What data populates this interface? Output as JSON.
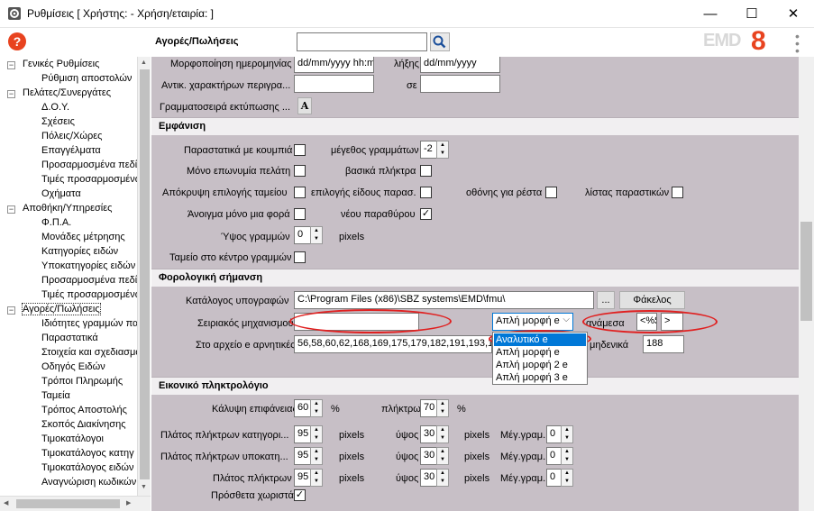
{
  "window": {
    "title": "Ρυθμίσεις   [ Χρήστης: - Χρήση/εταιρία: ]",
    "minimize": "—",
    "maximize": "☐",
    "close": "✕"
  },
  "toolbar": {
    "help": "?",
    "label": "Αγορές/Πωλήσεις",
    "search_value": "",
    "logo_text": "EMD",
    "logo_num": "8"
  },
  "tree": [
    {
      "label": "Γενικές Ρυθμίσεις",
      "level": 0,
      "toggle": "−"
    },
    {
      "label": "Ρύθμιση αποστολών",
      "level": 1
    },
    {
      "label": "Πελάτες/Συνεργάτες",
      "level": 0,
      "toggle": "−"
    },
    {
      "label": "Δ.Ο.Υ.",
      "level": 1
    },
    {
      "label": "Σχέσεις",
      "level": 1
    },
    {
      "label": "Πόλεις/Χώρες",
      "level": 1
    },
    {
      "label": "Επαγγέλματα",
      "level": 1
    },
    {
      "label": "Προσαρμοσμένα πεδί",
      "level": 1
    },
    {
      "label": "Τιμές προσαρμοσμένων",
      "level": 1
    },
    {
      "label": "Οχήματα",
      "level": 1
    },
    {
      "label": "Αποθήκη/Υπηρεσίες",
      "level": 0,
      "toggle": "−"
    },
    {
      "label": "Φ.Π.Α.",
      "level": 1
    },
    {
      "label": "Μονάδες μέτρησης",
      "level": 1
    },
    {
      "label": "Κατηγορίες ειδών",
      "level": 1
    },
    {
      "label": "Υποκατηγορίες ειδών",
      "level": 1
    },
    {
      "label": "Προσαρμοσμένα πεδί",
      "level": 1
    },
    {
      "label": "Τιμές προσαρμοσμένων",
      "level": 1
    },
    {
      "label": "Αγορές/Πωλήσεις",
      "level": 0,
      "toggle": "−",
      "selected": true
    },
    {
      "label": "Ιδιότητες γραμμών πα",
      "level": 1
    },
    {
      "label": "Παραστατικά",
      "level": 1
    },
    {
      "label": "Στοιχεία και σχεδιασμό",
      "level": 1
    },
    {
      "label": "Οδηγός Ειδών",
      "level": 1
    },
    {
      "label": "Τρόποι Πληρωμής",
      "level": 1
    },
    {
      "label": "Ταμεία",
      "level": 1
    },
    {
      "label": "Τρόπος Αποστολής",
      "level": 1
    },
    {
      "label": "Σκοπός Διακίνησης",
      "level": 1
    },
    {
      "label": "Τιμοκατάλογοι",
      "level": 1
    },
    {
      "label": "Τιμοκατάλογος κατηγ",
      "level": 1
    },
    {
      "label": "Τιμοκατάλογος ειδών",
      "level": 1
    },
    {
      "label": "Αναγνώριση κωδικών",
      "level": 1
    }
  ],
  "top": {
    "date_format_label": "Μορφοποίηση ημερομηνίας",
    "date_format_value": "dd/mm/yyyy hh:m",
    "expiry_label": "λήξης",
    "expiry_value": "dd/mm/yyyy",
    "replace_chars_label": "Αντικ. χαρακτήρων περιγρα...",
    "replace_chars_value": "",
    "with_label": "σε",
    "with_value": "",
    "print_font_label": "Γραμματοσειρά εκτύπωσης ...",
    "print_font_button": "A"
  },
  "appearance": {
    "header": "Εμφάνιση",
    "docs_buttons": "Παραστατικά με κουμπιά",
    "docs_buttons_checked": false,
    "row_size_label": "μέγεθος γραμμάτων",
    "row_size_value": "-2",
    "named_only": "Μόνο επωνυμία πελάτη",
    "named_only_checked": false,
    "basic_keys": "βασικά πλήκτρα",
    "basic_keys_checked": false,
    "hide_cash": "Απόκρυψη επιλογής ταμείου",
    "hide_cash_checked": false,
    "doc_type": "επιλογής είδους παρασ.",
    "doc_type_checked": false,
    "screen_change": "οθόνης για ρέστα",
    "screen_change_checked": false,
    "doc_list": "λίστας παραστικών",
    "doc_list_checked": false,
    "open_once": "Άνοιγμα μόνο μια φορά",
    "open_once_checked": false,
    "new_window": "νέου παραθύρου",
    "new_window_checked": true,
    "row_height_label": "Ύψος γραμμών",
    "row_height_value": "0",
    "row_height_unit": "pixels",
    "cash_center": "Ταμείο στο κέντρο γραμμών",
    "cash_center_checked": false
  },
  "fiscal": {
    "header": "Φορολογική σήμανση",
    "sign_dir_label": "Κατάλογος υπογραφών",
    "sign_dir_value": "C:\\Program Files (x86)\\SBZ systems\\EMD\\fmu\\",
    "browse_button": "...",
    "folder_button": "Φάκελος",
    "serial_label": "Σειριακός μηχανισμού",
    "serial_value": "",
    "mode_value": "Απλή μορφή e",
    "between_label": "ανάμεσα",
    "between_from": "<%$",
    "between_to": ">",
    "neg_label": "Στο αρχείο e αρνητικές αξίες",
    "neg_value": "56,58,60,62,168,169,175,179,182,191,193,1",
    "zero_label": "μηδενικά",
    "zero_value": "188",
    "dropdown_options": [
      "Αναλυτικό e",
      "Απλή μορφή e",
      "Απλή μορφή 2 e",
      "Απλή μορφή 3 e"
    ],
    "dropdown_selected": 0
  },
  "keyboard": {
    "header": "Εικονικό πληκτρολόγιο",
    "coverage_label": "Κάλυψη επιφάνειας",
    "coverage_value": "60",
    "coverage_unit": "%",
    "keys_label": "πλήκτρων",
    "keys_value": "70",
    "keys_unit": "%",
    "rows": [
      {
        "label": "Πλάτος πλήκτρων κατηγορι...",
        "w": "95",
        "wu": "pixels",
        "hl": "ύψος",
        "h": "30",
        "hu": "pixels",
        "ml": "Μέγ.γραμ.",
        "m": "0"
      },
      {
        "label": "Πλάτος πλήκτρων υποκατη...",
        "w": "95",
        "wu": "pixels",
        "hl": "ύψος",
        "h": "30",
        "hu": "pixels",
        "ml": "Μέγ.γραμ.",
        "m": "0"
      },
      {
        "label": "Πλάτος πλήκτρων",
        "w": "95",
        "wu": "pixels",
        "hl": "ύψος",
        "h": "30",
        "hu": "pixels",
        "ml": "Μέγ.γραμ.",
        "m": "0"
      }
    ],
    "extra_sep": "Πρόσθετα χωριστά",
    "extra_sep_checked": true
  },
  "colors": {
    "accent": "#e8431f",
    "highlight": "#0078d7",
    "panel": "#c7bfc6"
  }
}
